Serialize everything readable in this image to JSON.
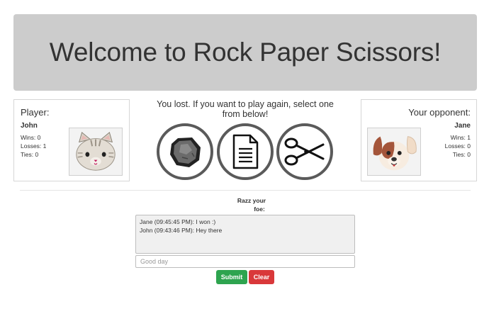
{
  "header": {
    "title": "Welcome to Rock Paper Scissors!"
  },
  "player": {
    "heading": "Player:",
    "name": "John",
    "wins": "Wins: 0",
    "losses": "Losses: 1",
    "ties": "Ties: 0",
    "avatar_icon": "cat-avatar-icon"
  },
  "opponent": {
    "heading": "Your opponent:",
    "name": "Jane",
    "wins": "Wins: 1",
    "losses": "Losses: 0",
    "ties": "Ties: 0",
    "avatar_icon": "dog-avatar-icon"
  },
  "game": {
    "status_line1": "You lost. If you want to play again, select one",
    "status_line2": "from below!",
    "choices": [
      "rock-icon",
      "paper-icon",
      "scissors-icon"
    ]
  },
  "chat": {
    "label_line1": "Razz your",
    "label_line2": "foe:",
    "messages": [
      "Jane (09:45:45 PM): I won :)",
      "John (09:43:46 PM): Hey there"
    ],
    "input_placeholder": "Good day",
    "submit_label": "Submit",
    "clear_label": "Clear"
  },
  "colors": {
    "header_bg": "#cccccc",
    "submit_button": "#2ea44f",
    "clear_button": "#d9383a",
    "choice_ring": "#5a5a5a"
  }
}
